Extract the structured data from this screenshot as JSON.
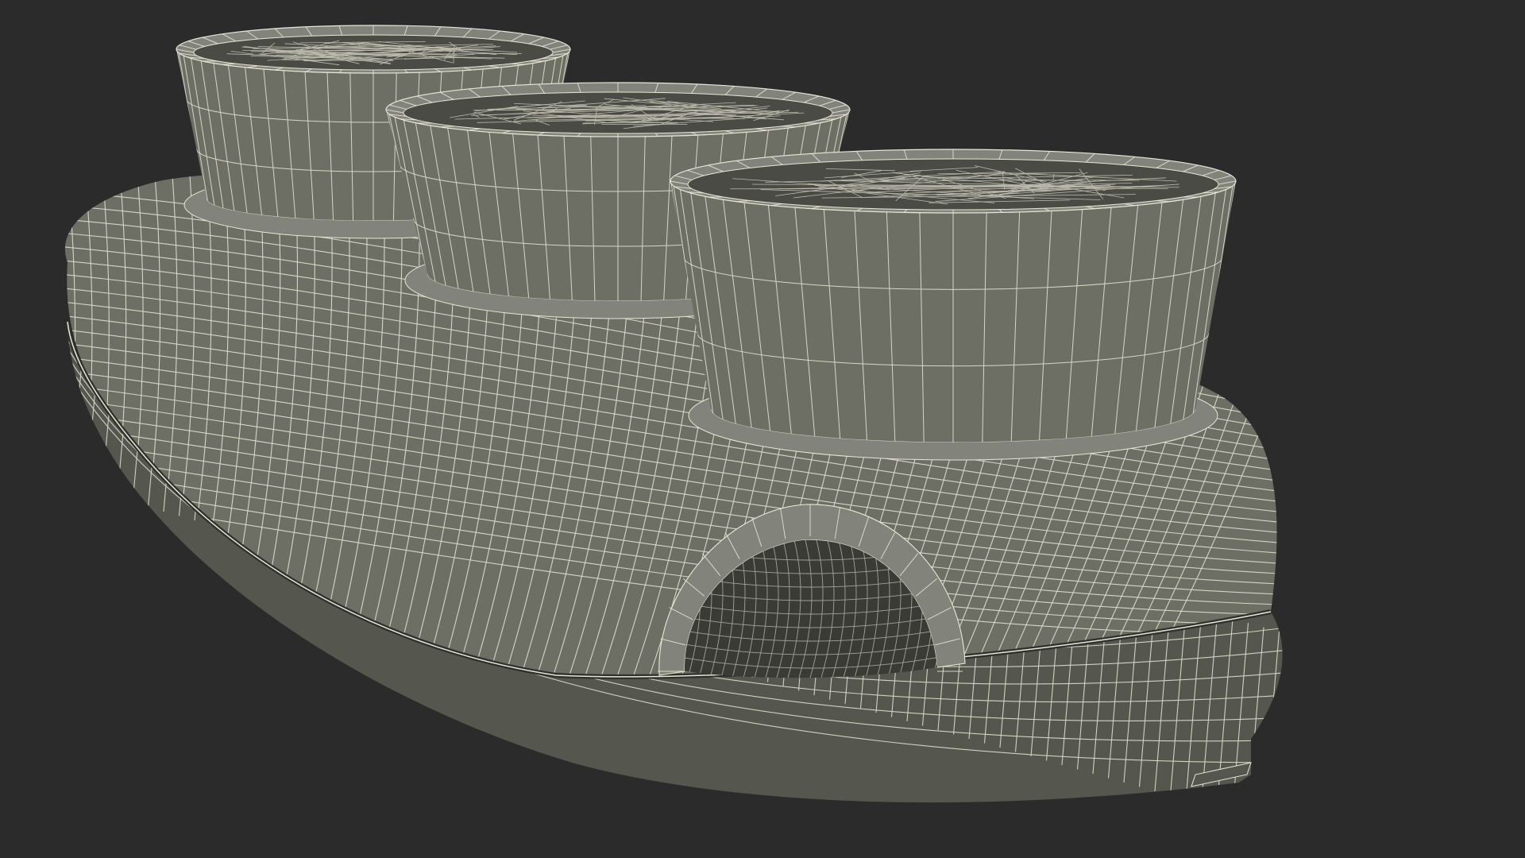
{
  "viewport": {
    "background_color": "#2b2b2b"
  },
  "model": {
    "surface_color": "#6e6f64",
    "surface_shadow_color": "#55564d",
    "surface_highlight_color": "#82837a",
    "interior_color": "#4a4b44",
    "deep_interior_color": "#3a3b35",
    "wire_color": "#e8e8d8",
    "parts": [
      {
        "name": "base-body"
      },
      {
        "name": "left-cup"
      },
      {
        "name": "middle-cup"
      },
      {
        "name": "right-cup"
      },
      {
        "name": "cable-hole"
      }
    ]
  }
}
